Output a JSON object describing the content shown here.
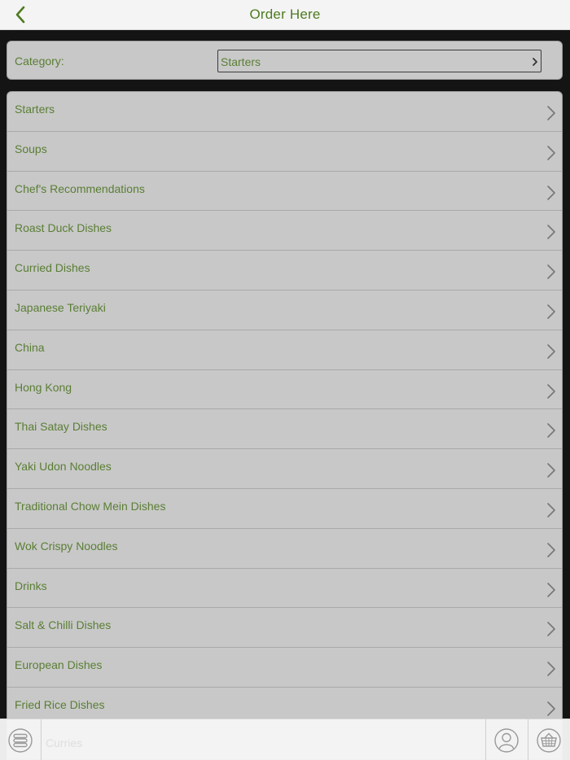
{
  "header": {
    "title": "Order Here",
    "back_icon": "chevron-left-icon"
  },
  "category": {
    "label": "Category:",
    "selected": "Starters"
  },
  "menu": {
    "items": [
      {
        "label": "Starters"
      },
      {
        "label": "Soups"
      },
      {
        "label": "Chef's Recommendations"
      },
      {
        "label": "Roast Duck Dishes"
      },
      {
        "label": "Curried Dishes"
      },
      {
        "label": "Japanese Teriyaki"
      },
      {
        "label": "China"
      },
      {
        "label": "Hong Kong"
      },
      {
        "label": "Thai Satay Dishes"
      },
      {
        "label": "Yaki Udon Noodles"
      },
      {
        "label": "Traditional Chow Mein Dishes"
      },
      {
        "label": "Wok Crispy Noodles"
      },
      {
        "label": "Drinks"
      },
      {
        "label": "Salt & Chilli Dishes"
      },
      {
        "label": "European Dishes"
      },
      {
        "label": "Fried Rice Dishes"
      }
    ]
  },
  "toolbar": {
    "peek_text": "Curries",
    "icons": [
      "menu-list-icon",
      "account-icon",
      "basket-icon"
    ]
  },
  "colors": {
    "accent": "#4e7b1f",
    "text": "#5a7e34",
    "panel": "#c8c8c8",
    "background": "#141414"
  }
}
